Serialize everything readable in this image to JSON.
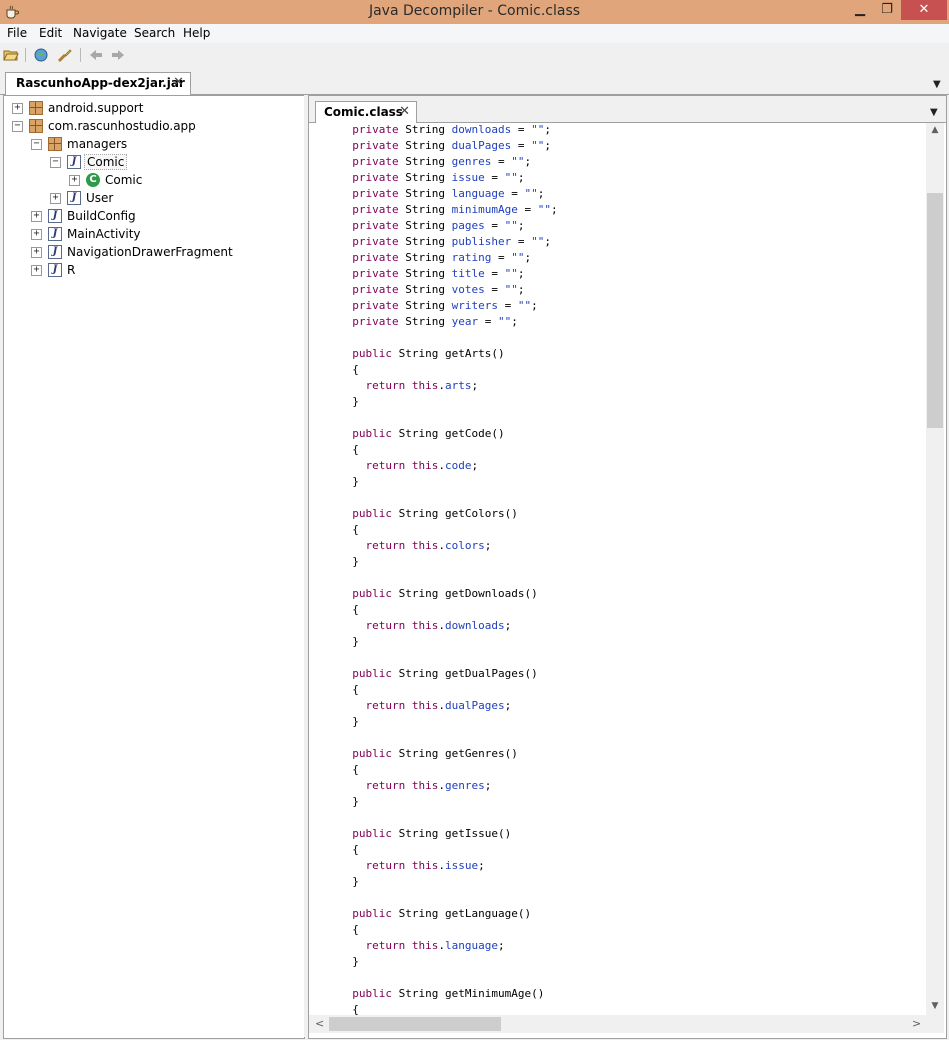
{
  "window": {
    "title": "Java Decompiler - Comic.class",
    "min_glyph": "▁",
    "max_glyph": "❐",
    "close_glyph": "✕"
  },
  "menu": {
    "file": "File",
    "edit": "Edit",
    "navigate": "Navigate",
    "search": "Search",
    "help": "Help"
  },
  "toolbar": {
    "icons": [
      "open-file-icon",
      "open-type-icon",
      "search-icon",
      "back-arrow-icon",
      "forward-arrow-icon"
    ]
  },
  "outer_tab": {
    "label": "RascunhoApp-dex2jar.jar",
    "close_glyph": "✕",
    "dropdown_glyph": "▼"
  },
  "tree": {
    "nodes": [
      {
        "label": "android.support"
      },
      {
        "label": "com.rascunhostudio.app"
      },
      {
        "label": "managers"
      },
      {
        "label": "Comic"
      },
      {
        "label": "Comic"
      },
      {
        "label": "User"
      },
      {
        "label": "BuildConfig"
      },
      {
        "label": "MainActivity"
      },
      {
        "label": "NavigationDrawerFragment"
      },
      {
        "label": "R"
      }
    ],
    "toggles": [
      "+",
      "−",
      "−",
      "−",
      "+",
      "+",
      "+",
      "+",
      "+",
      "+"
    ]
  },
  "editor": {
    "tab_label": "Comic.class",
    "tab_close_glyph": "✕",
    "dropdown_glyph": "▼",
    "code": [
      "  private String downloads = \"\";",
      "  private String dualPages = \"\";",
      "  private String genres = \"\";",
      "  private String issue = \"\";",
      "  private String language = \"\";",
      "  private String minimumAge = \"\";",
      "  private String pages = \"\";",
      "  private String publisher = \"\";",
      "  private String rating = \"\";",
      "  private String title = \"\";",
      "  private String votes = \"\";",
      "  private String writers = \"\";",
      "  private String year = \"\";",
      "",
      "  public String getArts()",
      "  {",
      "    return this.arts;",
      "  }",
      "",
      "  public String getCode()",
      "  {",
      "    return this.code;",
      "  }",
      "",
      "  public String getColors()",
      "  {",
      "    return this.colors;",
      "  }",
      "",
      "  public String getDownloads()",
      "  {",
      "    return this.downloads;",
      "  }",
      "",
      "  public String getDualPages()",
      "  {",
      "    return this.dualPages;",
      "  }",
      "",
      "  public String getGenres()",
      "  {",
      "    return this.genres;",
      "  }",
      "",
      "  public String getIssue()",
      "  {",
      "    return this.issue;",
      "  }",
      "",
      "  public String getLanguage()",
      "  {",
      "    return this.language;",
      "  }",
      "",
      "  public String getMinimumAge()",
      "  {"
    ]
  },
  "scroll": {
    "up_glyph": "▲",
    "down_glyph": "▼",
    "left_glyph": "<",
    "right_glyph": ">"
  },
  "colors": {
    "keyword": "#7f0055",
    "field": "#1f3fbf",
    "title_bar": "#e0a57a",
    "close_button": "#c75050"
  }
}
